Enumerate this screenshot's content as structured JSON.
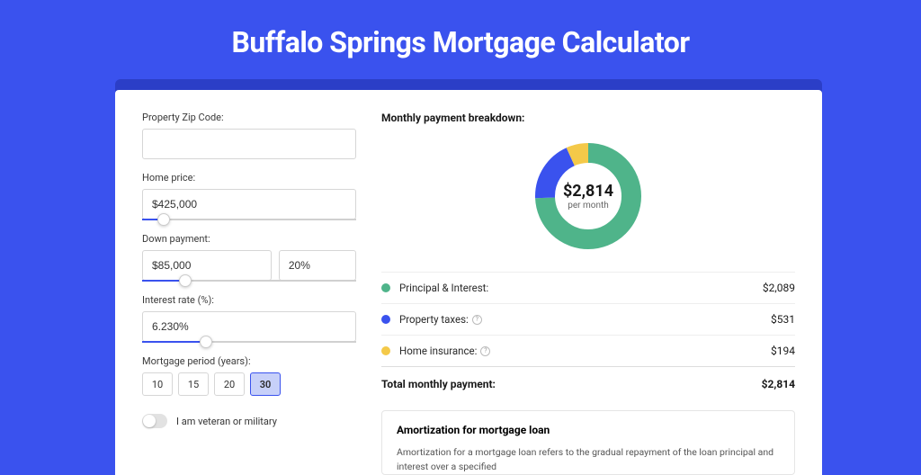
{
  "title": "Buffalo Springs Mortgage Calculator",
  "form": {
    "zip_label": "Property Zip Code:",
    "zip_value": "",
    "home_price_label": "Home price:",
    "home_price_value": "$425,000",
    "home_price_slider_pct": 10,
    "down_payment_label": "Down payment:",
    "down_payment_value": "$85,000",
    "down_payment_pct_value": "20%",
    "down_payment_slider_pct": 20,
    "interest_label": "Interest rate (%):",
    "interest_value": "6.230%",
    "interest_slider_pct": 30,
    "period_label": "Mortgage period (years):",
    "periods": [
      "10",
      "15",
      "20",
      "30"
    ],
    "period_active": "30",
    "veteran_label": "I am veteran or military",
    "veteran_on": false
  },
  "breakdown": {
    "title": "Monthly payment breakdown:",
    "total_amount": "$2,814",
    "total_sub": "per month",
    "rows": [
      {
        "label": "Principal & Interest:",
        "value": "$2,089",
        "color": "#4fb48a",
        "info": false
      },
      {
        "label": "Property taxes:",
        "value": "$531",
        "color": "#3a52ee",
        "info": true
      },
      {
        "label": "Home insurance:",
        "value": "$194",
        "color": "#f4c949",
        "info": true
      }
    ],
    "total_label": "Total monthly payment:",
    "total_value": "$2,814"
  },
  "chart_data": {
    "type": "pie",
    "title": "Monthly payment breakdown",
    "series": [
      {
        "name": "Principal & Interest",
        "value": 2089,
        "color": "#4fb48a"
      },
      {
        "name": "Property taxes",
        "value": 531,
        "color": "#3a52ee"
      },
      {
        "name": "Home insurance",
        "value": 194,
        "color": "#f4c949"
      }
    ],
    "total": 2814,
    "center_label": "$2,814",
    "center_sub": "per month"
  },
  "amort": {
    "title": "Amortization for mortgage loan",
    "text": "Amortization for a mortgage loan refers to the gradual repayment of the loan principal and interest over a specified"
  }
}
